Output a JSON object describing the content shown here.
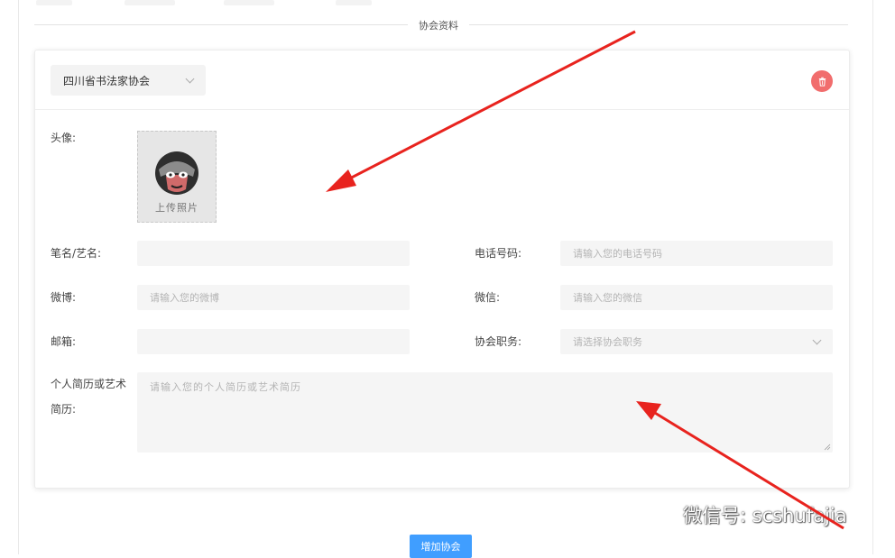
{
  "section": {
    "title": "协会资料"
  },
  "association": {
    "selected": "四川省书法家协会",
    "delete_icon": "trash-icon"
  },
  "form": {
    "avatar_label": "头像:",
    "upload_label": "上传照片",
    "pen_name_label": "笔名/艺名:",
    "pen_name_placeholder": "",
    "phone_label": "电话号码:",
    "phone_placeholder": "请输入您的电话号码",
    "weibo_label": "微博:",
    "weibo_placeholder": "请输入您的微博",
    "wechat_label": "微信:",
    "wechat_placeholder": "请输入您的微信",
    "email_label": "邮箱:",
    "email_placeholder": "",
    "position_label": "协会职务:",
    "position_placeholder": "请选择协会职务",
    "bio_label_line1": "个人简历或艺术",
    "bio_label_line2": "简历:",
    "bio_placeholder": "请输入您的个人简历或艺术简历"
  },
  "actions": {
    "add_label": "增加协会"
  },
  "watermark": {
    "text": "微信号: scshufajia"
  },
  "colors": {
    "primary": "#409eff",
    "danger": "#f16d6d",
    "annotation_arrow": "#e8231e"
  }
}
